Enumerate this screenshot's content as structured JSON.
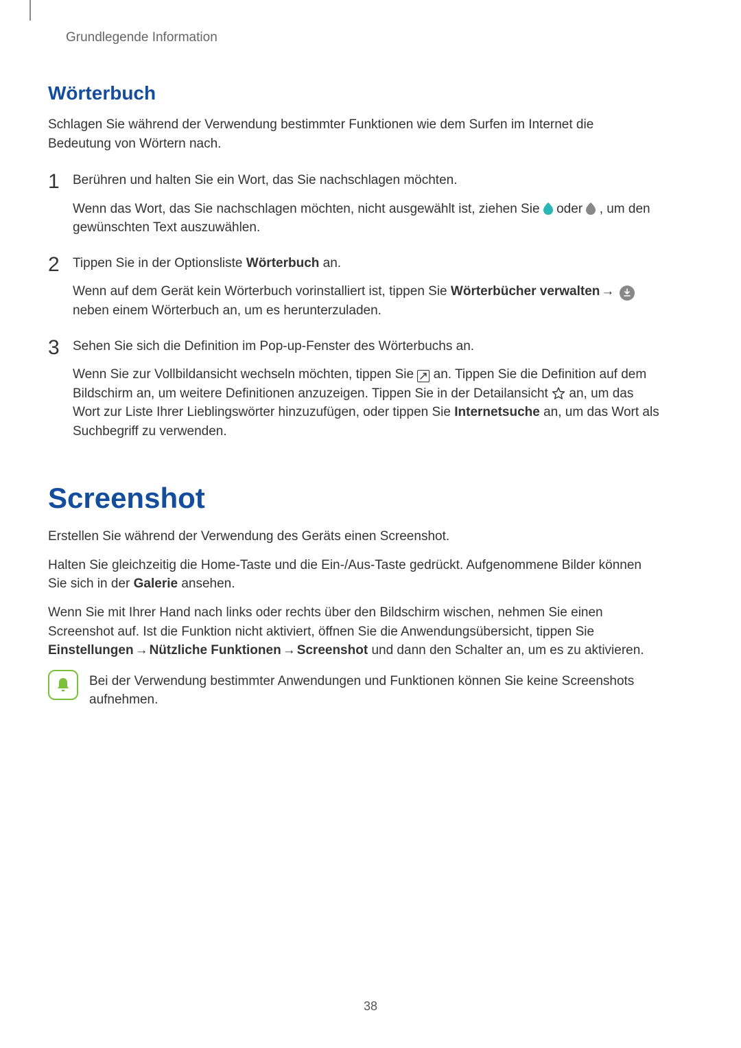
{
  "page_number": "38",
  "running_header": "Grundlegende Information",
  "subhead_1": "Wörterbuch",
  "intro_1": "Schlagen Sie während der Verwendung bestimmter Funktionen wie dem Surfen im Internet die Bedeutung von Wörtern nach.",
  "steps": [
    {
      "num": "1",
      "line1": "Berühren und halten Sie ein Wort, das Sie nachschlagen möchten.",
      "line2a": "Wenn das Wort, das Sie nachschlagen möchten, nicht ausgewählt ist, ziehen Sie ",
      "line2_sep": " oder ",
      "line2b": ", um den gewünschten Text auszuwählen."
    },
    {
      "num": "2",
      "line1a": "Tippen Sie in der Optionsliste ",
      "line1_bold": "Wörterbuch",
      "line1b": " an.",
      "line2a": "Wenn auf dem Gerät kein Wörterbuch vorinstalliert ist, tippen Sie ",
      "line2_bold": "Wörterbücher verwalten",
      "line2_arrow": " → ",
      "line2b": " neben einem Wörterbuch an, um es herunterzuladen."
    },
    {
      "num": "3",
      "line1": "Sehen Sie sich die Definition im Pop-up-Fenster des Wörterbuchs an.",
      "line2a": "Wenn Sie zur Vollbildansicht wechseln möchten, tippen Sie ",
      "line2b": " an. Tippen Sie die Definition auf dem Bildschirm an, um weitere Definitionen anzuzeigen. Tippen Sie in der Detailansicht ",
      "line2c": " an, um das Wort zur Liste Ihrer Lieblingswörter hinzuzufügen, oder tippen Sie ",
      "line2_bold": "Internetsuche",
      "line2d": " an, um das Wort als Suchbegriff zu verwenden."
    }
  ],
  "h1_main": "Screenshot",
  "ss_p1": "Erstellen Sie während der Verwendung des Geräts einen Screenshot.",
  "ss_p2a": "Halten Sie gleichzeitig die Home-Taste und die Ein-/Aus-Taste gedrückt. Aufgenommene Bilder können Sie sich in der ",
  "ss_p2_bold": "Galerie",
  "ss_p2b": " ansehen.",
  "ss_p3a": "Wenn Sie mit Ihrer Hand nach links oder rechts über den Bildschirm wischen, nehmen Sie einen Screenshot auf. Ist die Funktion nicht aktiviert, öffnen Sie die Anwendungsübersicht, tippen Sie ",
  "ss_p3_bold1": "Einstellungen",
  "ss_p3_arrow1": " → ",
  "ss_p3_bold2": "Nützliche Funktionen",
  "ss_p3_arrow2": " → ",
  "ss_p3_bold3": "Screenshot",
  "ss_p3b": " und dann den Schalter an, um es zu aktivieren.",
  "note_text": "Bei der Verwendung bestimmter Anwendungen und Funktionen können Sie keine Screenshots aufnehmen.",
  "colors": {
    "heading": "#144d9c",
    "handle_left": "#28b7b5",
    "handle_right": "#888888",
    "note_border": "#7bbf3a"
  }
}
